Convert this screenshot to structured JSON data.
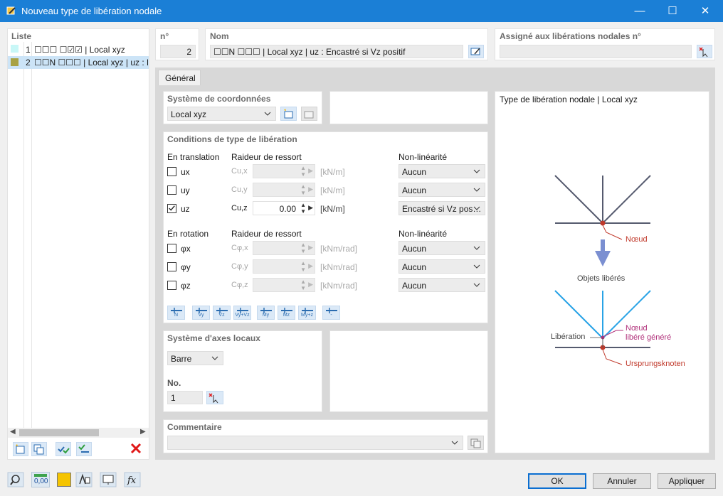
{
  "window": {
    "title": "Nouveau type de libération nodale",
    "minimize": "—",
    "maximize": "☐",
    "close": "✕"
  },
  "list": {
    "header": "Liste",
    "items": [
      {
        "num": "1",
        "label": "☐☐☐ ☐☑☑ | Local xyz",
        "color": "#c8f7f7"
      },
      {
        "num": "2",
        "label": "☐☐N ☐☐☐ | Local xyz | uz : En",
        "color": "#a8a244"
      }
    ]
  },
  "header": {
    "no_label": "n°",
    "no_value": "2",
    "name_label": "Nom",
    "name_value": "☐☐N ☐☐☐ | Local xyz | uz : Encastré si Vz positif",
    "assigned_label": "Assigné aux libérations nodales n°",
    "assigned_value": ""
  },
  "tabs": [
    "Général"
  ],
  "coord": {
    "title": "Système de coordonnées",
    "value": "Local xyz"
  },
  "conditions": {
    "title": "Conditions de type de libération",
    "translation_label": "En translation",
    "spring_label": "Raideur de ressort",
    "nonlin_label": "Non-linéarité",
    "rotation_label": "En rotation",
    "spring_label2": "Raideur de ressort",
    "nonlin_label2": "Non-linéarité",
    "translation": [
      {
        "dof": "ux",
        "spring": "Cu,x",
        "value": "",
        "unit": "[kN/m]",
        "nonlin": "Aucun",
        "checked": false
      },
      {
        "dof": "uy",
        "spring": "Cu,y",
        "value": "",
        "unit": "[kN/m]",
        "nonlin": "Aucun",
        "checked": false
      },
      {
        "dof": "uz",
        "spring": "Cu,z",
        "value": "0.00",
        "unit": "[kN/m]",
        "nonlin": "Encastré si Vz pos…",
        "checked": true
      }
    ],
    "rotation": [
      {
        "dof": "φx",
        "spring": "Cφ,x",
        "value": "",
        "unit": "[kNm/rad]",
        "nonlin": "Aucun",
        "checked": false
      },
      {
        "dof": "φy",
        "spring": "Cφ,y",
        "value": "",
        "unit": "[kNm/rad]",
        "nonlin": "Aucun",
        "checked": false
      },
      {
        "dof": "φz",
        "spring": "Cφ,z",
        "value": "",
        "unit": "[kNm/rad]",
        "nonlin": "Aucun",
        "checked": false
      }
    ],
    "preset_buttons": [
      "N",
      "Vy",
      "Vz",
      "Vy+Vz",
      "My",
      "Mz",
      "My+z",
      "-"
    ]
  },
  "local_axes": {
    "title": "Système d'axes locaux",
    "type_value": "Barre",
    "no_label": "No.",
    "no_value": "1"
  },
  "comment": {
    "title": "Commentaire",
    "value": ""
  },
  "diagram": {
    "title": "Type de libération nodale | Local xyz",
    "node_label": "Nœud",
    "released_objects": "Objets libérés",
    "release_label": "Libération",
    "generated_node_line1": "Nœud",
    "generated_node_line2": "libéré généré",
    "origin_node": "Ursprungsknoten",
    "color_node": "#c0392b",
    "color_generated": "#b0307a",
    "color_released": "#29a3e6"
  },
  "footer": {
    "ok": "OK",
    "cancel": "Annuler",
    "apply": "Appliquer",
    "units_badge": "0,00"
  }
}
